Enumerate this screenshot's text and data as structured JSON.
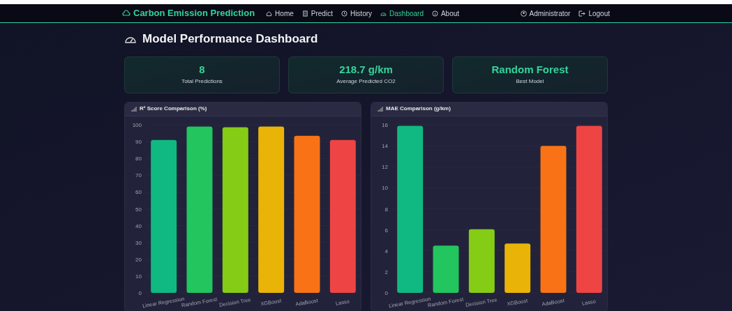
{
  "nav": {
    "brand": "Carbon Emission Prediction",
    "links": [
      {
        "label": "Home",
        "selected": false
      },
      {
        "label": "Predict",
        "selected": false
      },
      {
        "label": "History",
        "selected": false
      },
      {
        "label": "Dashboard",
        "selected": true
      },
      {
        "label": "About",
        "selected": false
      }
    ],
    "user": "Administrator",
    "logout": "Logout"
  },
  "title": "Model Performance Dashboard",
  "stats": [
    {
      "value": "8",
      "label": "Total Predictions"
    },
    {
      "value": "218.7 g/km",
      "label": "Average Predicted CO2"
    },
    {
      "value": "Random Forest",
      "label": "Best Model"
    }
  ],
  "charts": [
    {
      "title": "R² Score Comparison (%)",
      "chart_data": {
        "type": "bar",
        "categories": [
          "Linear Regression",
          "Random Forest",
          "Decision Tree",
          "XGBoost",
          "AdaBoost",
          "Lasso"
        ],
        "values": [
          91,
          99,
          98.5,
          99,
          93.5,
          91
        ],
        "ylim": [
          0,
          100
        ],
        "yticks": [
          0,
          10,
          20,
          30,
          40,
          50,
          60,
          70,
          80,
          90,
          100
        ],
        "grid": true
      }
    },
    {
      "title": "MAE Comparison (g/km)",
      "chart_data": {
        "type": "bar",
        "categories": [
          "Linear Regression",
          "Random Forest",
          "Decision Tree",
          "XGBoost",
          "AdaBoost",
          "Lasso"
        ],
        "values": [
          15.9,
          4.5,
          6.05,
          4.7,
          14,
          15.9
        ],
        "ylim": [
          0,
          16
        ],
        "yticks": [
          0,
          2,
          4,
          6,
          8,
          10,
          12,
          14,
          16
        ],
        "grid": true
      }
    }
  ]
}
